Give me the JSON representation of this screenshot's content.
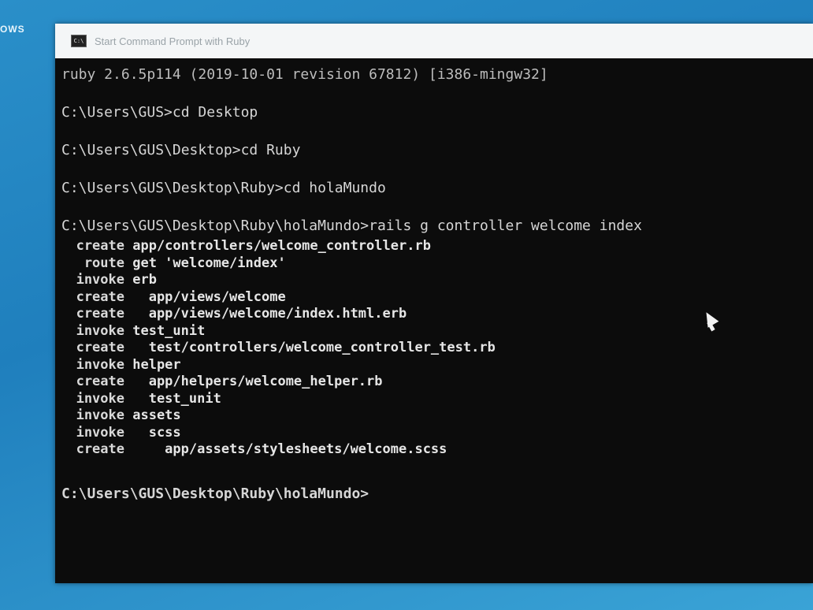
{
  "desktop": {
    "corner_text": "OWS"
  },
  "window": {
    "title": "Start Command Prompt with Ruby"
  },
  "console": {
    "lines": [
      "ruby 2.6.5p114 (2019-10-01 revision 67812) [i386-mingw32]",
      "C:\\Users\\GUS>cd Desktop",
      "C:\\Users\\GUS\\Desktop>cd Ruby",
      "C:\\Users\\GUS\\Desktop\\Ruby>cd holaMundo",
      "C:\\Users\\GUS\\Desktop\\Ruby\\holaMundo>rails g controller welcome index"
    ],
    "output": [
      {
        "verb": "create",
        "text": " app/controllers/welcome_controller.rb"
      },
      {
        "verb": "route",
        "text": " get 'welcome/index'"
      },
      {
        "verb": "invoke",
        "text": " erb"
      },
      {
        "verb": "create",
        "text": "   app/views/welcome"
      },
      {
        "verb": "create",
        "text": "   app/views/welcome/index.html.erb"
      },
      {
        "verb": "invoke",
        "text": " test_unit"
      },
      {
        "verb": "create",
        "text": "   test/controllers/welcome_controller_test.rb"
      },
      {
        "verb": "invoke",
        "text": " helper"
      },
      {
        "verb": "create",
        "text": "   app/helpers/welcome_helper.rb"
      },
      {
        "verb": "invoke",
        "text": "   test_unit"
      },
      {
        "verb": "invoke",
        "text": " assets"
      },
      {
        "verb": "invoke",
        "text": "   scss"
      },
      {
        "verb": "create",
        "text": "     app/assets/stylesheets/welcome.scss"
      }
    ],
    "prompt": "C:\\Users\\GUS\\Desktop\\Ruby\\holaMundo>"
  }
}
